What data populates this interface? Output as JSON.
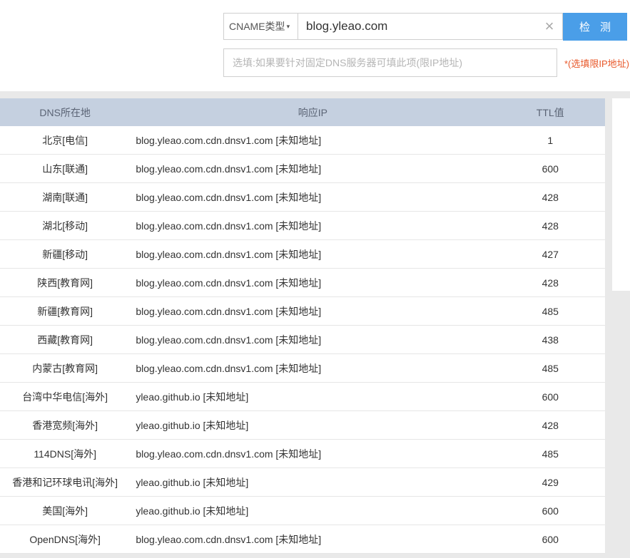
{
  "search": {
    "type_label": "CNAME类型",
    "type_caret": "▾",
    "domain_value": "blog.yleao.com",
    "clear_glyph": "×",
    "detect_label": "检测",
    "dns_placeholder": "选填:如果要针对固定DNS服务器可填此项(限IP地址)",
    "dns_hint": "*(选填限IP地址)"
  },
  "table": {
    "headers": {
      "location": "DNS所在地",
      "ip": "响应IP",
      "ttl": "TTL值"
    },
    "rows": [
      {
        "location": "北京[电信]",
        "ip": "blog.yleao.com.cdn.dnsv1.com [未知地址]",
        "ttl": "1"
      },
      {
        "location": "山东[联通]",
        "ip": "blog.yleao.com.cdn.dnsv1.com [未知地址]",
        "ttl": "600"
      },
      {
        "location": "湖南[联通]",
        "ip": "blog.yleao.com.cdn.dnsv1.com [未知地址]",
        "ttl": "428"
      },
      {
        "location": "湖北[移动]",
        "ip": "blog.yleao.com.cdn.dnsv1.com [未知地址]",
        "ttl": "428"
      },
      {
        "location": "新疆[移动]",
        "ip": "blog.yleao.com.cdn.dnsv1.com [未知地址]",
        "ttl": "427"
      },
      {
        "location": "陕西[教育网]",
        "ip": "blog.yleao.com.cdn.dnsv1.com [未知地址]",
        "ttl": "428"
      },
      {
        "location": "新疆[教育网]",
        "ip": "blog.yleao.com.cdn.dnsv1.com [未知地址]",
        "ttl": "485"
      },
      {
        "location": "西藏[教育网]",
        "ip": "blog.yleao.com.cdn.dnsv1.com [未知地址]",
        "ttl": "438"
      },
      {
        "location": "内蒙古[教育网]",
        "ip": "blog.yleao.com.cdn.dnsv1.com [未知地址]",
        "ttl": "485"
      },
      {
        "location": "台湾中华电信[海外]",
        "ip": "yleao.github.io [未知地址]",
        "ttl": "600"
      },
      {
        "location": "香港宽频[海外]",
        "ip": "yleao.github.io [未知地址]",
        "ttl": "428"
      },
      {
        "location": "114DNS[海外]",
        "ip": "blog.yleao.com.cdn.dnsv1.com [未知地址]",
        "ttl": "485"
      },
      {
        "location": "香港和记环球电讯[海外]",
        "ip": "yleao.github.io [未知地址]",
        "ttl": "429"
      },
      {
        "location": "美国[海外]",
        "ip": "yleao.github.io [未知地址]",
        "ttl": "600"
      },
      {
        "location": "OpenDNS[海外]",
        "ip": "blog.yleao.com.cdn.dnsv1.com [未知地址]",
        "ttl": "600"
      }
    ]
  }
}
